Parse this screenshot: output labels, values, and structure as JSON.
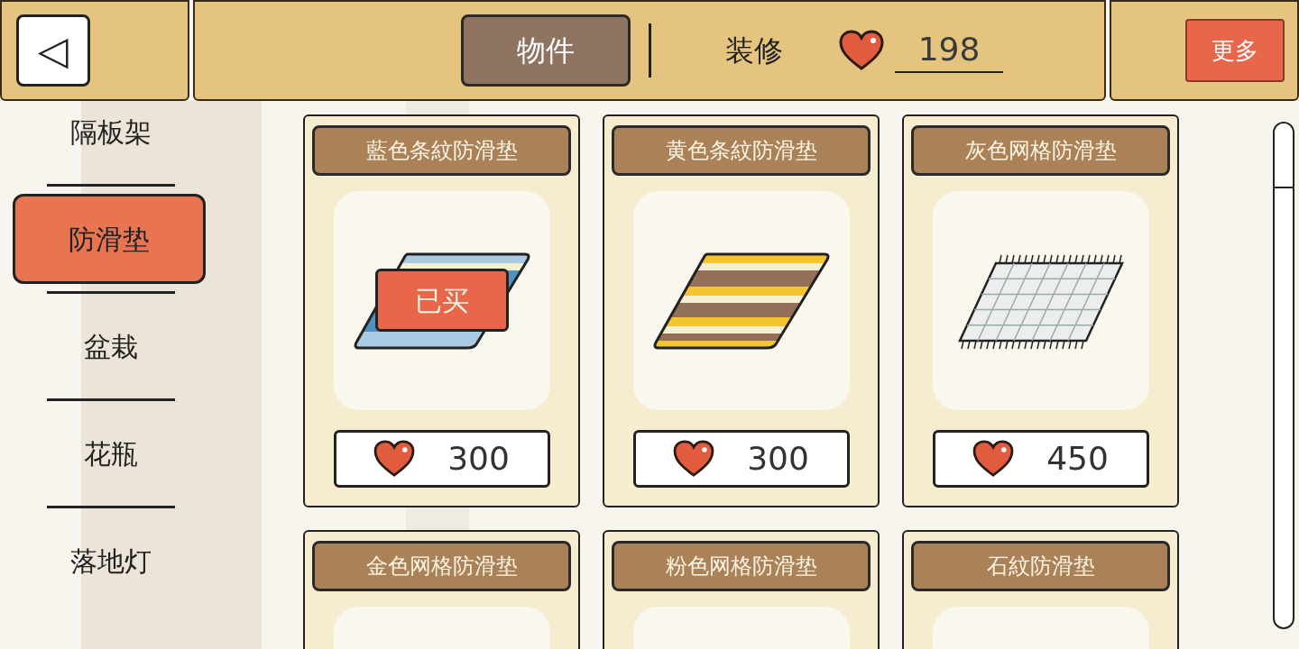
{
  "back_button": {
    "label": "◁"
  },
  "tabs": [
    {
      "label": "物件",
      "selected": true
    },
    {
      "label": "装修",
      "selected": false
    }
  ],
  "hearts": {
    "count": "198"
  },
  "more_button": {
    "label": "更多"
  },
  "sidebar": {
    "items": [
      {
        "label": "隔板架",
        "selected": false
      },
      {
        "label": "防滑垫",
        "selected": true
      },
      {
        "label": "盆栽",
        "selected": false
      },
      {
        "label": "花瓶",
        "selected": false
      },
      {
        "label": "落地灯",
        "selected": false
      }
    ]
  },
  "items": [
    {
      "name": "藍色条紋防滑垫",
      "kind": "blue_stripes",
      "price": "300",
      "purchased": true,
      "badge": "已买"
    },
    {
      "name": "黄色条紋防滑垫",
      "kind": "yellow_stripes",
      "price": "300",
      "purchased": false
    },
    {
      "name": "灰色网格防滑垫",
      "kind": "gray_grid",
      "price": "450",
      "purchased": false
    },
    {
      "name": "金色网格防滑垫",
      "purchased": false
    },
    {
      "name": "粉色网格防滑垫",
      "purchased": false
    },
    {
      "name": "石紋防滑垫",
      "purchased": false
    }
  ]
}
